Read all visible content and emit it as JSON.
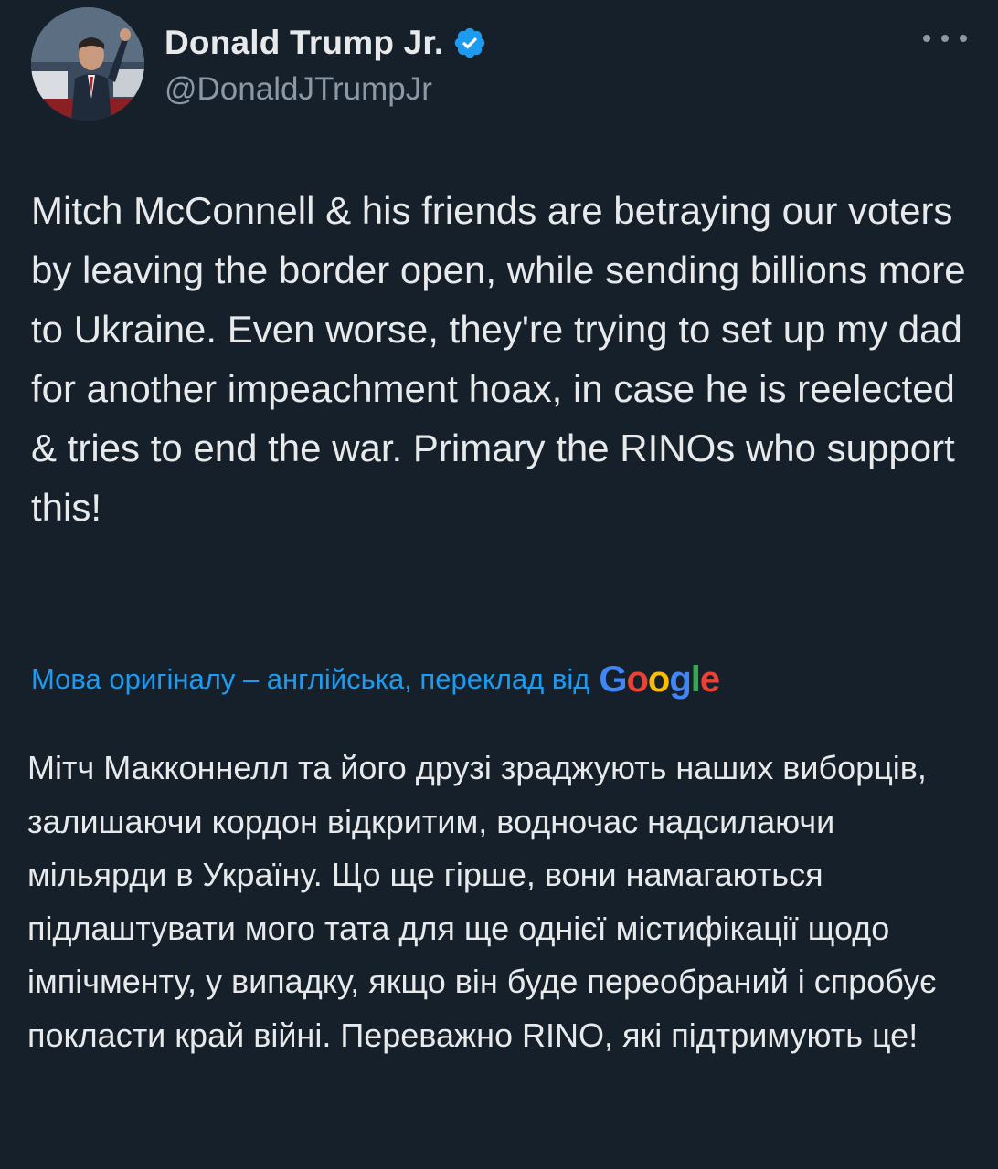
{
  "author": {
    "name": "Donald Trump Jr.",
    "handle": "@DonaldJTrumpJr",
    "verified": true,
    "avatar_icon": "profile-photo",
    "verified_icon": "verified-badge-icon"
  },
  "menu": {
    "icon": "more-options-icon"
  },
  "tweet": {
    "text": "Mitch McConnell & his friends are betraying our voters by leaving the border open, while sending billions more to Ukraine. Even worse, they're trying to set up my dad for another impeachment hoax, in case he is reelected & tries to end the war. Primary the RINOs who support this!"
  },
  "translation": {
    "label": "Мова оригіналу – англійська, переклад від",
    "provider": "Google",
    "provider_letters": [
      "G",
      "o",
      "o",
      "g",
      "l",
      "e"
    ],
    "text": "Мітч Макконнелл та його друзі зраджують наших виборців, залишаючи кордон відкритим, водночас надсилаючи мільярди в Україну. Що ще гірше, вони намагаються підлаштувати мого тата для ще однієї містифікації щодо імпічменту, у випадку, якщо він буде переобраний і спробує покласти край війні. Переважно RINO, які підтримують це!"
  },
  "colors": {
    "background": "#15202b",
    "text": "#e7e9ea",
    "secondary": "#8b98a5",
    "accent": "#1d9bf0",
    "google_blue": "#4285f4",
    "google_red": "#ea4335",
    "google_yellow": "#fbbc05",
    "google_green": "#34a853"
  }
}
